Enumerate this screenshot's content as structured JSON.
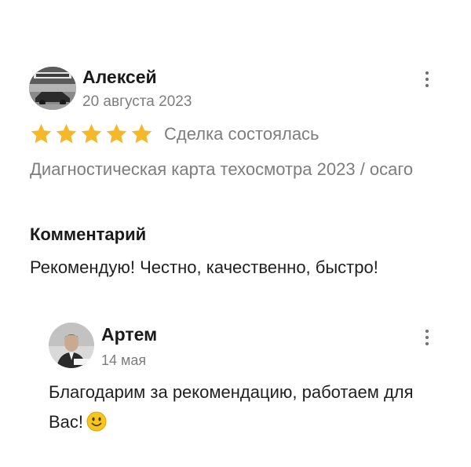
{
  "review": {
    "author": {
      "name": "Алексей",
      "date": "20 августа 2023"
    },
    "rating": {
      "stars": 5,
      "max": 5,
      "star_color": "#f5b829"
    },
    "deal_status": "Сделка состоялась",
    "service": "Диагностическая карта техосмотра 2023 / осаго",
    "comment_heading": "Комментарий",
    "comment_text": "Рекомендую! Честно, качественно, быстро!"
  },
  "reply": {
    "author": {
      "name": "Артем",
      "date": "14 мая"
    },
    "text": "Благодарим за рекомендацию, работаем для Вас!",
    "emoji": "slightly-smiling-face-icon"
  },
  "icons": {
    "more": "more-vertical-icon",
    "star": "star-icon"
  }
}
